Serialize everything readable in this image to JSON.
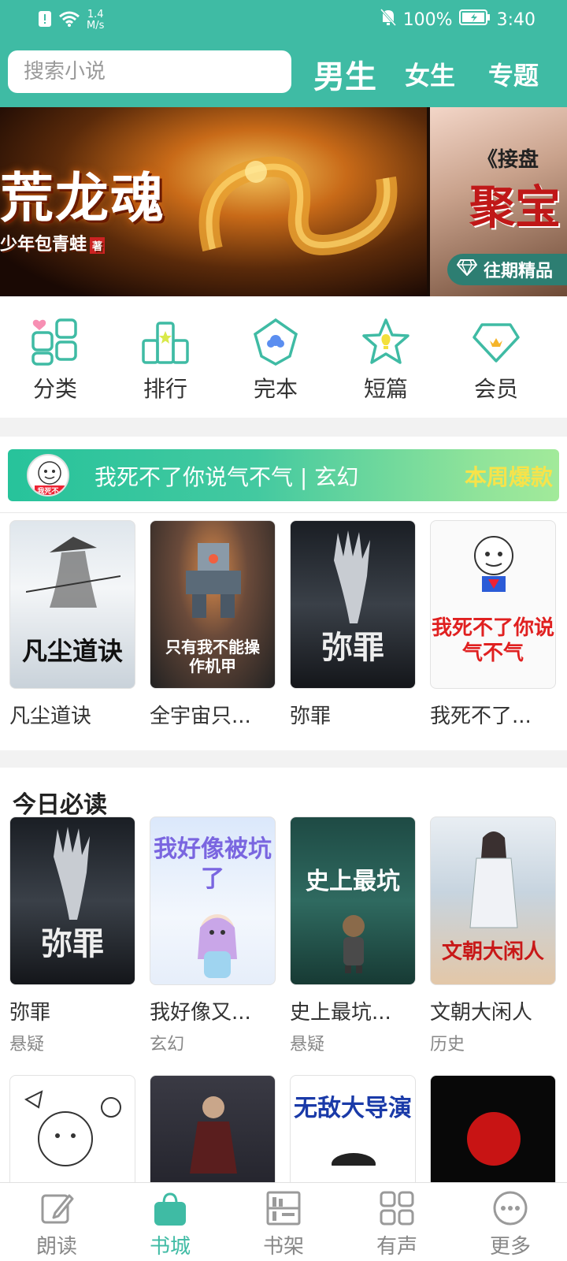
{
  "status_bar": {
    "speed_value": "1.4",
    "speed_unit": "M/s",
    "battery": "100%",
    "time": "3:40"
  },
  "header": {
    "search_placeholder": "搜索小说",
    "tabs": [
      {
        "label": "男生",
        "active": true
      },
      {
        "label": "女生"
      },
      {
        "label": "专题"
      }
    ]
  },
  "banner": {
    "slides": [
      {
        "title": "荒龙魂",
        "author": "少年包青蛙",
        "author_tag": "著"
      },
      {
        "subtitle": "《接盘",
        "title": "聚宝",
        "badge": "往期精品"
      }
    ],
    "dot_count": 8,
    "active_dot": 4
  },
  "categories": [
    {
      "label": "分类",
      "icon": "category-icon"
    },
    {
      "label": "排行",
      "icon": "ranking-icon"
    },
    {
      "label": "完本",
      "icon": "completed-icon"
    },
    {
      "label": "短篇",
      "icon": "short-story-icon"
    },
    {
      "label": "会员",
      "icon": "vip-icon"
    }
  ],
  "weekly": {
    "promo_text": "我死不了你说气不气 | 玄幻",
    "promo_tag": "本周爆款",
    "promo_avatar_text": "我死不",
    "books": [
      {
        "title": "凡尘道诀",
        "cover_text": "凡尘道诀"
      },
      {
        "title": "全宇宙只...",
        "cover_text": "只有我不能操作机甲"
      },
      {
        "title": "弥罪",
        "cover_text": "弥罪"
      },
      {
        "title": "我死不了...",
        "cover_text": "我死不了你说气不气"
      }
    ]
  },
  "today": {
    "title": "今日必读",
    "books": [
      {
        "title": "弥罪",
        "genre": "悬疑",
        "cover_text": "弥罪"
      },
      {
        "title": "我好像又...",
        "genre": "玄幻",
        "cover_text": "我好像被坑了"
      },
      {
        "title": "史上最坑...",
        "genre": "悬疑",
        "cover_text": "史上最坑"
      },
      {
        "title": "文朝大闲人",
        "genre": "历史",
        "cover_text": "文朝大闲人"
      }
    ],
    "more_books": [
      {
        "cover_text": ""
      },
      {
        "cover_text": ""
      },
      {
        "cover_text": "无敌大导演"
      },
      {
        "cover_text": ""
      }
    ]
  },
  "bottom_nav": [
    {
      "label": "朗读",
      "icon": "edit-icon"
    },
    {
      "label": "书城",
      "icon": "store-icon",
      "active": true
    },
    {
      "label": "书架",
      "icon": "bookshelf-icon"
    },
    {
      "label": "有声",
      "icon": "grid-icon"
    },
    {
      "label": "更多",
      "icon": "more-icon"
    }
  ],
  "colors": {
    "primary": "#3fbba4",
    "promo_tag": "#f7e34a",
    "text": "#333333",
    "muted": "#888888"
  }
}
